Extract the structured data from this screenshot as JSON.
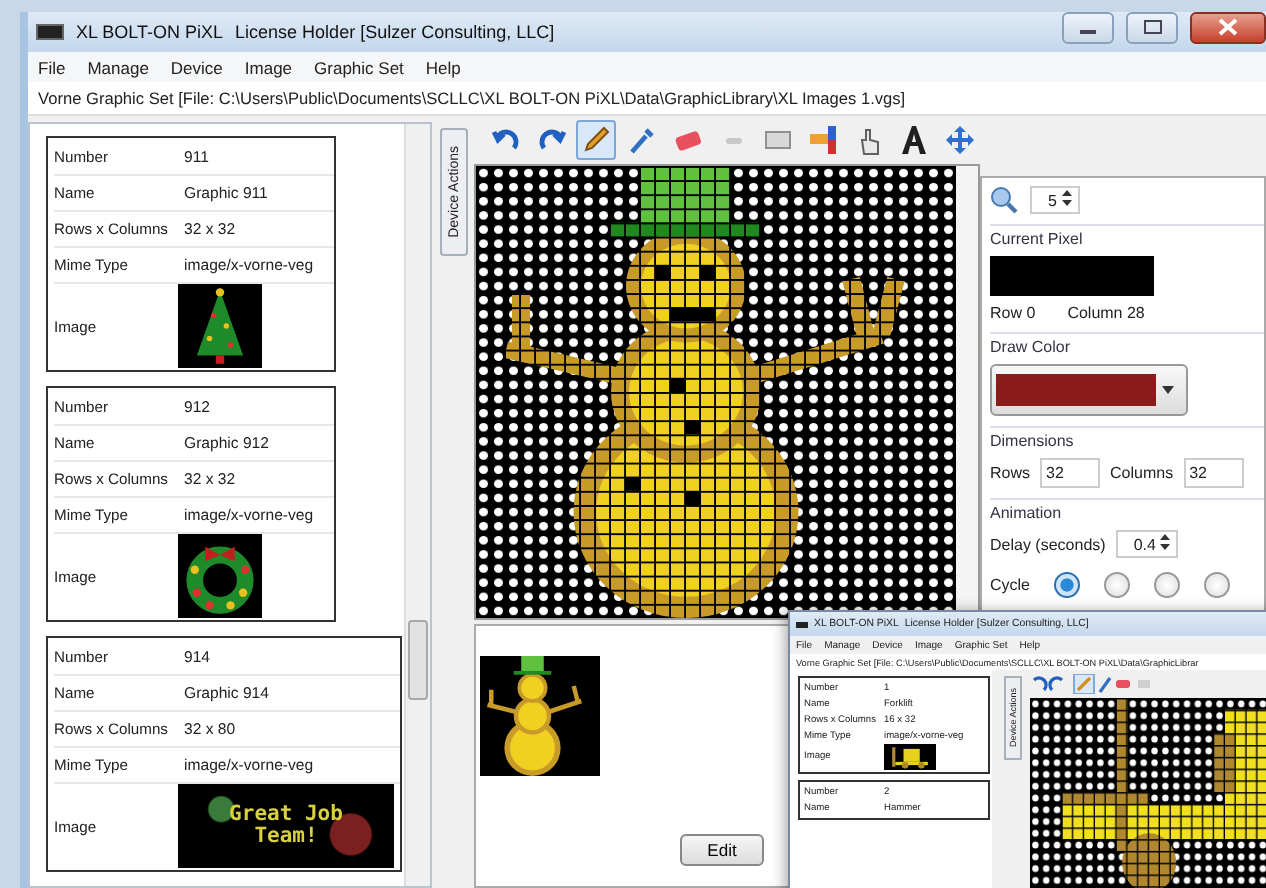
{
  "window": {
    "title": "XL BOLT-ON PiXL",
    "subtitle": "License Holder [Sulzer Consulting, LLC]"
  },
  "menu": [
    "File",
    "Manage",
    "Device",
    "Image",
    "Graphic Set",
    "Help"
  ],
  "file_path": "Vorne Graphic Set [File: C:\\Users\\Public\\Documents\\SCLLC\\XL BOLT-ON PiXL\\Data\\GraphicLibrary\\XL Images 1.vgs]",
  "graphics": [
    {
      "kind": "tree",
      "fields": [
        {
          "label": "Number",
          "value": "911"
        },
        {
          "label": "Name",
          "value": "Graphic 911"
        },
        {
          "label": "Rows x Columns",
          "value": "32  x  32"
        },
        {
          "label": "Mime Type",
          "value": "image/x-vorne-veg"
        }
      ],
      "image_label": "Image"
    },
    {
      "kind": "wreath",
      "fields": [
        {
          "label": "Number",
          "value": "912"
        },
        {
          "label": "Name",
          "value": "Graphic 912"
        },
        {
          "label": "Rows x Columns",
          "value": "32  x  32"
        },
        {
          "label": "Mime Type",
          "value": "image/x-vorne-veg"
        }
      ],
      "image_label": "Image"
    },
    {
      "kind": "banner",
      "image_text": "Great Job Team!",
      "fields": [
        {
          "label": "Number",
          "value": "914"
        },
        {
          "label": "Name",
          "value": "Graphic 914"
        },
        {
          "label": "Rows x Columns",
          "value": "32  x  80"
        },
        {
          "label": "Mime Type",
          "value": "image/x-vorne-veg"
        }
      ],
      "image_label": "Image"
    }
  ],
  "side_tab": "Device Actions",
  "toolbar": [
    {
      "kind": "undo",
      "selected": false
    },
    {
      "kind": "redo",
      "selected": false
    },
    {
      "kind": "pencil",
      "selected": true
    },
    {
      "kind": "picker",
      "selected": false
    },
    {
      "kind": "eraser",
      "selected": false
    },
    {
      "kind": "line",
      "selected": false
    },
    {
      "kind": "rect",
      "selected": false
    },
    {
      "kind": "fill",
      "selected": false
    },
    {
      "kind": "hand",
      "selected": false
    },
    {
      "kind": "text",
      "selected": false
    },
    {
      "kind": "move",
      "selected": false
    }
  ],
  "edit_button": "Edit",
  "properties": {
    "zoom": "5",
    "current_pixel": {
      "title": "Current Pixel",
      "row": "Row 0",
      "column": "Column 28"
    },
    "draw_color": {
      "title": "Draw Color"
    },
    "dimensions": {
      "title": "Dimensions",
      "rows_label": "Rows",
      "rows": "32",
      "columns_label": "Columns",
      "columns": "32"
    },
    "animation": {
      "title": "Animation",
      "delay_label": "Delay (seconds)",
      "delay": "0.4",
      "cycle_label": "Cycle",
      "cycle": [
        {
          "selected": true
        },
        {
          "selected": false
        },
        {
          "selected": false
        },
        {
          "selected": false
        }
      ]
    }
  },
  "inset_window": {
    "title": "XL BOLT-ON PiXL",
    "subtitle": "License Holder [Sulzer Consulting, LLC]",
    "menu": [
      "File",
      "Manage",
      "Device",
      "Image",
      "Graphic Set",
      "Help"
    ],
    "file_path": "Vorne Graphic Set [File: C:\\Users\\Public\\Documents\\SCLLC\\XL BOLT-ON PiXL\\Data\\GraphicLibrar",
    "side_tab": "Device Actions",
    "graphics": [
      {
        "fields": [
          {
            "label": "Number",
            "value": "1"
          },
          {
            "label": "Name",
            "value": "Forklift"
          },
          {
            "label": "Rows x Columns",
            "value": "16  x  32"
          },
          {
            "label": "Mime Type",
            "value": "image/x-vorne-veg"
          }
        ],
        "image_label": "Image"
      },
      {
        "fields": [
          {
            "label": "Number",
            "value": "2"
          },
          {
            "label": "Name",
            "value": "Hammer"
          }
        ]
      }
    ]
  }
}
